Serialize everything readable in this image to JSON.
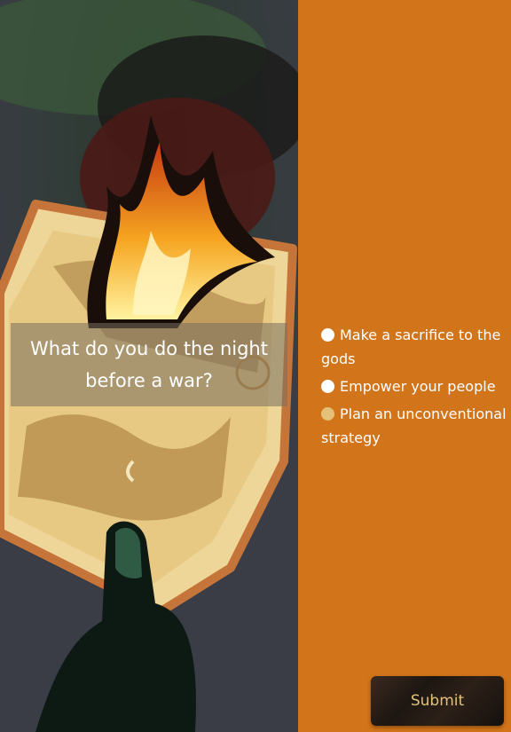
{
  "question": {
    "text": "What do you do the night before a war?"
  },
  "options": [
    {
      "label": "Make a sacrifice to the gods",
      "selected": false
    },
    {
      "label": "Empower your people",
      "selected": false
    },
    {
      "label": "Plan an unconventional strategy",
      "selected": true
    }
  ],
  "submit": {
    "label": "Submit"
  },
  "colors": {
    "panel_background": "#d1741a",
    "selected_radio": "#e3c178",
    "submit_text": "#e3c178"
  }
}
